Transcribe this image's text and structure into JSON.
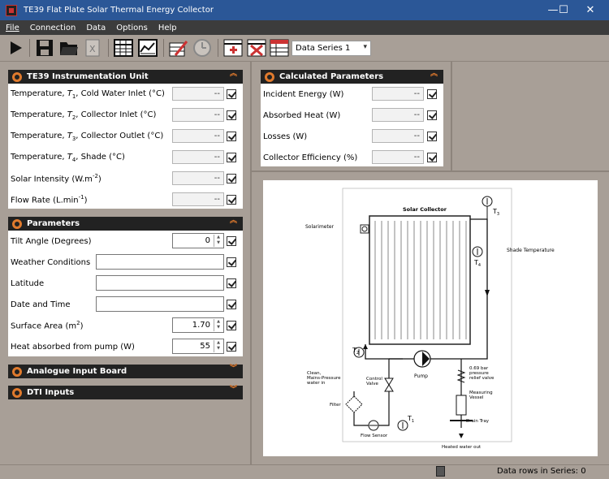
{
  "window": {
    "title": "TE39 Flat Plate Solar Thermal Energy Collector",
    "minimize": "—",
    "maximize": "☐",
    "close": "✕"
  },
  "menu": [
    "File",
    "Connection",
    "Data",
    "Options",
    "Help"
  ],
  "toolbar": {
    "series_selected": "Data Series 1",
    "icons": [
      "play-icon",
      "save-icon",
      "open-folder-icon",
      "export-excel-icon",
      "table-view-icon",
      "chart-view-icon",
      "edit-icon",
      "clock-icon",
      "add-row-icon",
      "delete-row-icon",
      "series-table-icon"
    ]
  },
  "instrumentation": {
    "title": "TE39 Instrumentation Unit",
    "rows": [
      {
        "label": "Temperature, T1, Cold Water Inlet  (°C)",
        "value": "--"
      },
      {
        "label": "Temperature, T2, Collector Inlet  (°C)",
        "value": "--"
      },
      {
        "label": "Temperature, T3, Collector Outlet  (°C)",
        "value": "--"
      },
      {
        "label": "Temperature, T4, Shade  (°C)",
        "value": "--"
      },
      {
        "label": "Solar Intensity  (W.m-2)",
        "value": "--"
      },
      {
        "label": "Flow Rate  (L.min-1)",
        "value": "--"
      }
    ]
  },
  "calculated": {
    "title": "Calculated Parameters",
    "rows": [
      {
        "label": "Incident Energy  (W)",
        "value": "--"
      },
      {
        "label": "Absorbed Heat  (W)",
        "value": "--"
      },
      {
        "label": "Losses  (W)",
        "value": "--"
      },
      {
        "label": "Collector Efficiency  (%)",
        "value": "--"
      }
    ]
  },
  "parameters": {
    "title": "Parameters",
    "tilt_label": "Tilt Angle  (Degrees)",
    "tilt_value": "0",
    "weather_label": "Weather Conditions",
    "latitude_label": "Latitude",
    "datetime_label": "Date and Time",
    "surface_label": "Surface Area  (m2)",
    "surface_value": "1.70",
    "heat_label": "Heat absorbed from pump  (W)",
    "heat_value": "55"
  },
  "analogue": {
    "title": "Analogue Input Board"
  },
  "dti": {
    "title": "DTI Inputs"
  },
  "diagram": {
    "solar_collector": "Solar Collector",
    "solarimeter": "Solarimeter",
    "shade_temperature": "Shade Temperature",
    "t1": "T",
    "t1s": "1",
    "t2": "T",
    "t2s": "2",
    "t3": "T",
    "t3s": "3",
    "t4": "T",
    "t4s": "4",
    "pump": "Pump",
    "relief": "0.69 bar\npressure\nrelief valve",
    "clean_water": "Clean,\nMains-Pressure\nwater in",
    "control_valve": "Control\nValve",
    "filter": "Filter",
    "flow_sensor": "Flow Sensor",
    "measuring_vessel": "Measuring\nVessel",
    "drain_tray": "Drain Tray",
    "heated_out": "Heated water out"
  },
  "status": {
    "rows_info": "Data rows in Series: 0"
  },
  "colors": {
    "accent": "#e07a2d",
    "titlebar": "#2b5797",
    "background": "#a89f97"
  }
}
